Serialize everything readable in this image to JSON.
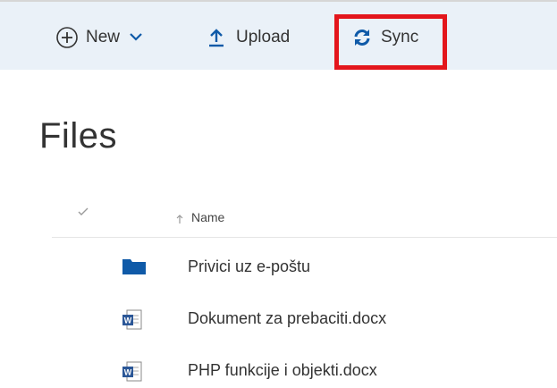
{
  "toolbar": {
    "new_label": "New",
    "upload_label": "Upload",
    "sync_label": "Sync"
  },
  "page": {
    "title": "Files"
  },
  "list": {
    "name_column": "Name",
    "items": [
      {
        "name": "Privici uz e-poštu",
        "type": "folder-icon"
      },
      {
        "name": "Dokument za prebaciti.docx",
        "type": "word-doc-icon"
      },
      {
        "name": "PHP funkcije i objekti.docx",
        "type": "word-doc-icon"
      }
    ]
  },
  "colors": {
    "toolbar_bg": "#eaf1f8",
    "accent_blue": "#0f5aa8",
    "highlight_red": "#e3161c"
  }
}
